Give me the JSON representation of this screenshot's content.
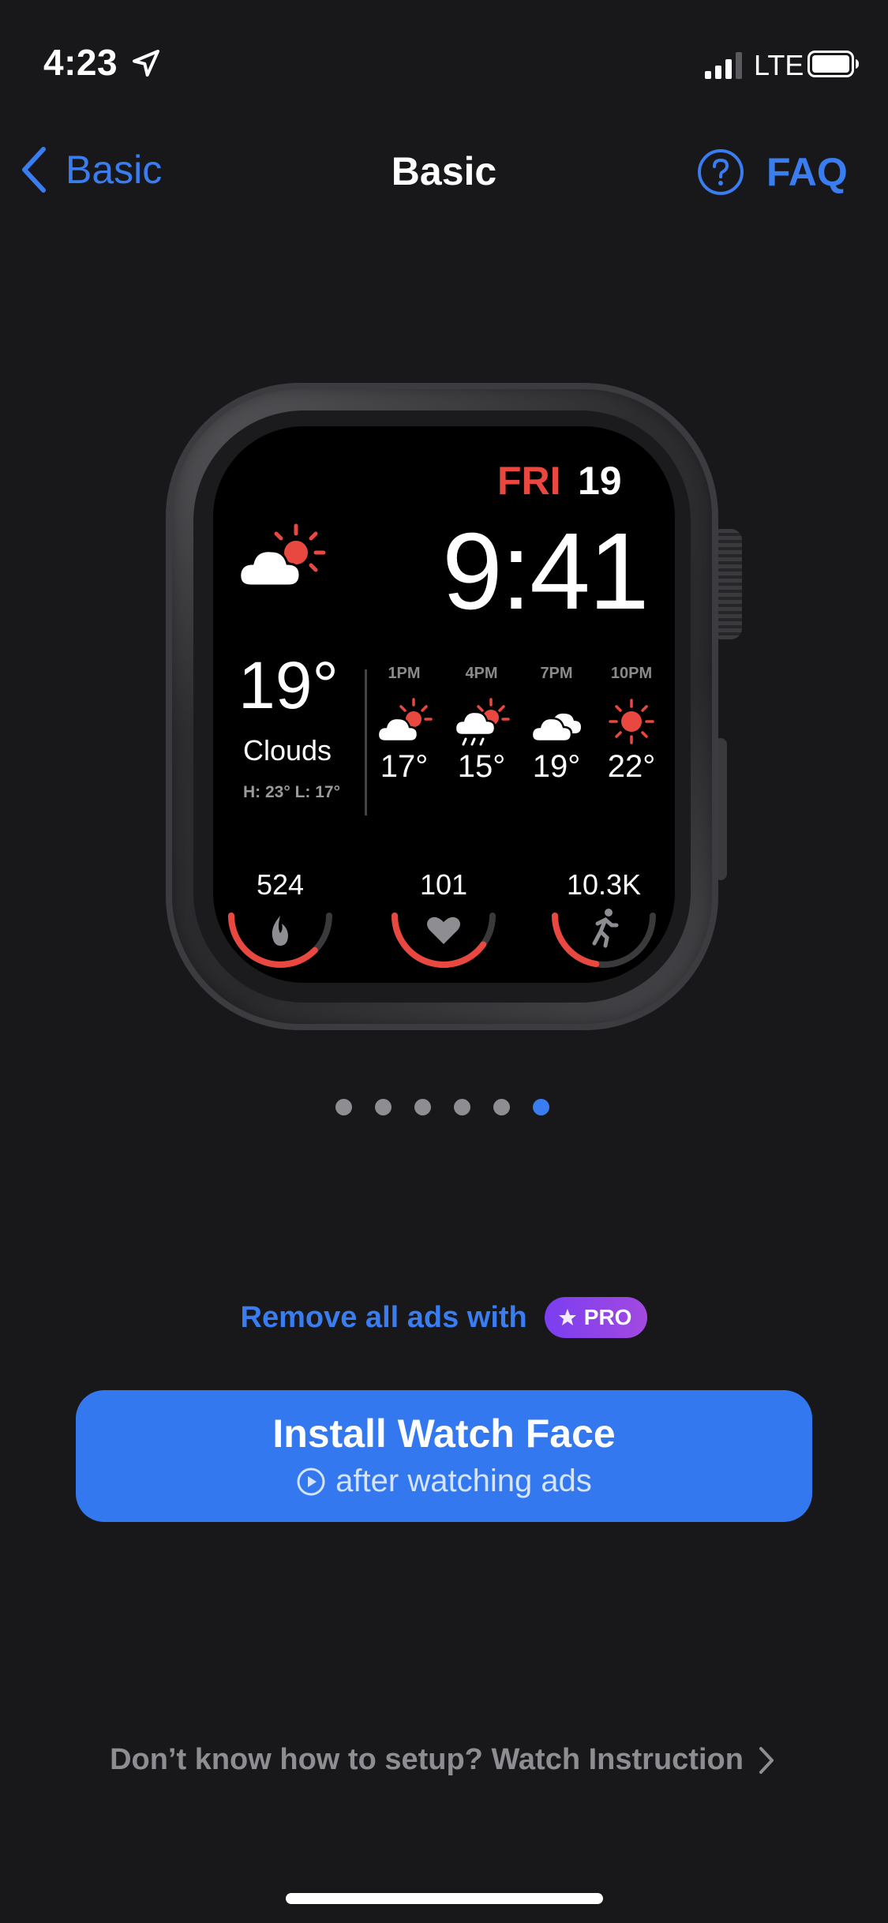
{
  "status_bar": {
    "time": "4:23",
    "carrier": "LTE",
    "location_icon": "location-arrow-icon",
    "signal_icon": "signal-bars-icon",
    "battery_icon": "battery-icon"
  },
  "nav": {
    "back_label": "Basic",
    "title": "Basic",
    "faq_label": "FAQ",
    "faq_icon": "question-circle-icon"
  },
  "watch_face": {
    "day": "FRI",
    "date": "19",
    "time": "9:41",
    "current": {
      "temp": "19°",
      "condition": "Clouds",
      "hi_lo": "H: 23°   L: 17°",
      "icon": "partly-sunny-icon"
    },
    "forecast": [
      {
        "time": "1PM",
        "temp": "17°",
        "icon": "partly-sunny-icon"
      },
      {
        "time": "4PM",
        "temp": "15°",
        "icon": "sun-rain-icon"
      },
      {
        "time": "7PM",
        "temp": "19°",
        "icon": "clouds-icon"
      },
      {
        "time": "10PM",
        "temp": "22°",
        "icon": "sun-icon"
      }
    ],
    "complications": [
      {
        "value": "524",
        "icon": "flame-icon",
        "progress": 0.75
      },
      {
        "value": "101",
        "icon": "heart-icon",
        "progress": 0.8
      },
      {
        "value": "10.3K",
        "icon": "running-icon",
        "progress": 0.45
      }
    ]
  },
  "pager": {
    "count": 6,
    "active_index": 5
  },
  "promo": {
    "text": "Remove all ads with",
    "badge": "PRO"
  },
  "install_button": {
    "title": "Install Watch Face",
    "subtitle": "after watching ads"
  },
  "instruction_link": {
    "text": "Don’t know how to setup? Watch Instruction"
  },
  "colors": {
    "accent": "#3478f0",
    "accent_text": "#3a7df0",
    "background": "#18181a",
    "watch_red": "#e8483f",
    "pro_gradient_start": "#7b3ef0",
    "pro_gradient_end": "#a349e0"
  }
}
